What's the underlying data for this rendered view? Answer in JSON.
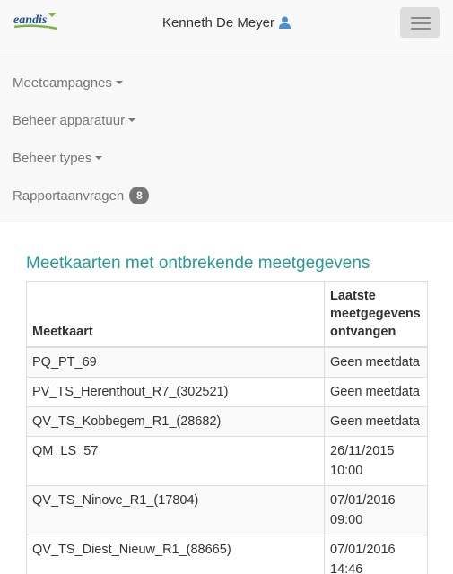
{
  "brand": {
    "logo_text": "eandis"
  },
  "user": {
    "name": "Kenneth De Meyer",
    "icon": "user-icon"
  },
  "menu": {
    "items": [
      {
        "label": "Meetcampagnes",
        "has_caret": true
      },
      {
        "label": "Beheer apparatuur",
        "has_caret": true
      },
      {
        "label": "Beheer types",
        "has_caret": true
      },
      {
        "label": "Rapportaanvragen",
        "badge": "8"
      }
    ]
  },
  "main": {
    "title": "Meetkaarten met ontbrekende meetgegevens",
    "columns": [
      "Meetkaart",
      "Laatste meetgegevens ontvangen"
    ],
    "rows": [
      {
        "meetkaart": "PQ_PT_69",
        "laatste": "Geen meetdata"
      },
      {
        "meetkaart": "PV_TS_Herenthout_R7_(302521)",
        "laatste": "Geen meetdata"
      },
      {
        "meetkaart": "QV_TS_Kobbegem_R1_(28682)",
        "laatste": "Geen meetdata"
      },
      {
        "meetkaart": "QM_LS_57",
        "laatste": "26/11/2015 10:00"
      },
      {
        "meetkaart": "QV_TS_Ninove_R1_(17804)",
        "laatste": "07/01/2016 09:00"
      },
      {
        "meetkaart": "QV_TS_Diest_Nieuw_R1_(88665)",
        "laatste": "07/01/2016 14:46"
      }
    ]
  },
  "colors": {
    "accent": "#269a95",
    "badge": "#777777",
    "logo_blue": "#1d4e9c",
    "logo_green": "#7ab648"
  }
}
